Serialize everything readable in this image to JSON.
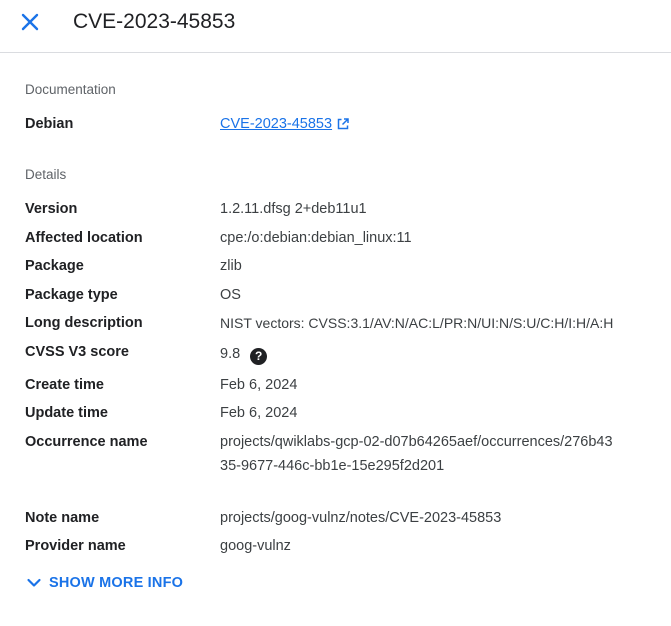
{
  "header": {
    "title": "CVE-2023-45853",
    "close_icon": "close-icon"
  },
  "documentation": {
    "section_label": "Documentation",
    "label": "Debian",
    "link_text": "CVE-2023-45853",
    "link_icon": "external-link-icon"
  },
  "details": {
    "section_label": "Details",
    "version": {
      "label": "Version",
      "value": "1.2.11.dfsg 2+deb11u1"
    },
    "affected_location": {
      "label": "Affected location",
      "value": "cpe:/o:debian:debian_linux:11"
    },
    "package": {
      "label": "Package",
      "value": "zlib"
    },
    "package_type": {
      "label": "Package type",
      "value": "OS"
    },
    "long_description": {
      "label": "Long description",
      "value": "NIST vectors: CVSS:3.1/AV:N/AC:L/PR:N/UI:N/S:U/C:H/I:H/A:H"
    },
    "cvss_score": {
      "label": "CVSS V3 score",
      "value": "9.8",
      "help_glyph": "?"
    },
    "create_time": {
      "label": "Create time",
      "value": "Feb 6, 2024"
    },
    "update_time": {
      "label": "Update time",
      "value": "Feb 6, 2024"
    },
    "occurrence_name": {
      "label": "Occurrence name",
      "value": "projects/qwiklabs-gcp-02-d07b64265aef/occurrences/276b4335-9677-446c-bb1e-15e295f2d201"
    },
    "note_name": {
      "label": "Note name",
      "value": "projects/goog-vulnz/notes/CVE-2023-45853"
    },
    "provider_name": {
      "label": "Provider name",
      "value": "goog-vulnz"
    }
  },
  "show_more": {
    "label": "SHOW MORE INFO",
    "icon": "chevron-down-icon"
  },
  "colors": {
    "accent": "#1a73e8",
    "divider": "#dadce0",
    "text": "#202124",
    "muted": "#5f6368"
  }
}
